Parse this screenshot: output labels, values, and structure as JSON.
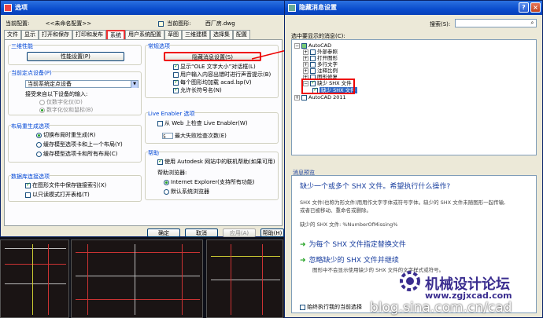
{
  "options_dialog": {
    "title": "选项",
    "current_config_label": "当前配置:",
    "current_config_value": "<<未命名配置>>",
    "current_drawing_label": "当前图形:",
    "current_drawing_value": "西厂房.dwg",
    "tabs": [
      "文件",
      "显示",
      "打开和保存",
      "打印和发布",
      "系统",
      "用户系统配置",
      "草图",
      "三维建模",
      "选择集",
      "配置"
    ],
    "active_tab_index": 4,
    "group_3d": {
      "title": "三维性能",
      "perf_button": "性能设置(P)"
    },
    "group_pointing": {
      "title": "当前定点设备(P)",
      "device_value": "当前系统定点设备",
      "accept_label": "接受来自以下设备的输入:",
      "radio_digitizer": "仅数字化仪(D)",
      "radio_digitizer_mouse": "数字化仪和鼠标(B)"
    },
    "group_layout": {
      "title": "布局重生成选项",
      "radio_1": "切换布局时重生成(R)",
      "radio_2": "缓存模型选项卡和上一个布局(Y)",
      "radio_3": "缓存模型选项卡和所有布局(C)"
    },
    "group_dbconn": {
      "title": "数据库连接选项",
      "cb_1": "在图形文件中保存链接索引(X)",
      "cb_2": "以只读模式打开表格(T)"
    },
    "group_general": {
      "title": "常规选项",
      "hidden_msg_button": "隐藏消息设置(S)",
      "cb_1": "显示“OLE 文字大小”对话框(L)",
      "cb_2": "用户输入内容出错时进行声音提示(B)",
      "cb_3": "每个图形均加载 acad.lsp(V)",
      "cb_4": "允许长符号名(N)"
    },
    "group_live": {
      "title": "Live Enabler 选项",
      "cb_1": "从 Web 上检查 Live Enabler(W)",
      "spin_value": "5",
      "spin_label": "最大失败检查次数(E)"
    },
    "group_help": {
      "title": "帮助",
      "cb_1": "使用 Autodesk 网站中的联机帮助(如果可用)",
      "browser_label": "帮助浏览器:",
      "radio_1": "Internet Explorer(支持所有功能)",
      "radio_2": "默认系统浏览器"
    },
    "buttons": {
      "ok": "确定",
      "cancel": "取消",
      "apply": "应用(A)",
      "help": "帮助(H)"
    }
  },
  "hidden_dialog": {
    "title": "隐藏消息设置",
    "search_label": "搜索(S):",
    "list_label": "选中要显示的消息(C):",
    "tree": {
      "root": "AutoCAD",
      "children": [
        "外部参照",
        "打开图形",
        "多行文字",
        "注释比例",
        "图形修复"
      ],
      "expanded_child": "缺少 SHX 文件",
      "selected_leaf": "缺少 SHX 文件",
      "root2": "AutoCAD 2011"
    },
    "preview": {
      "label": "消息预览",
      "title": "缺少一个或多个 SHX 文件。希望执行什么操作?",
      "body_1": "SHX 文件(也称为形文件)用用作文字字体或符号字体。缺少的 SHX 文件未随图形一起传输,",
      "body_2": "或者已被移动、重命名或删除。",
      "body_3": "缺少的 SHX 文件: %NumberOfMissing%",
      "action_1": "为每个 SHX 文件指定替换文件",
      "action_2": "忽略缺少的 SHX 文件并继续",
      "action_2_sub": "图形中不会显示使用缺少的 SHX 文件的文字样式或符号。",
      "always_label": "始终执行我的当前选择"
    }
  },
  "watermark": {
    "forum": "机械设计论坛",
    "url": "www.zgjxcad.com",
    "blog": "blog.sina.com.cn/cad"
  }
}
